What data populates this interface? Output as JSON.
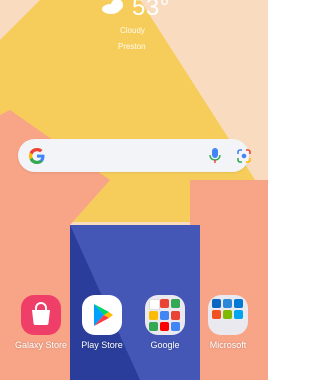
{
  "weather": {
    "temperature": "53°",
    "condition": "Cloudy",
    "location": "Preston",
    "icon": "partly-cloudy-icon"
  },
  "search": {
    "value": "",
    "icons": [
      "google-g-icon",
      "microphone-icon",
      "google-lens-icon"
    ]
  },
  "apps": [
    {
      "label": "Galaxy Store",
      "icon": "shopping-bag-icon",
      "color": "#ef3f68"
    },
    {
      "label": "Play Store",
      "icon": "play-triangle-icon",
      "color": "#ffffff"
    },
    {
      "label": "Google",
      "icon": "folder-icon",
      "color": "#e9e9ef"
    },
    {
      "label": "Microsoft",
      "icon": "folder-icon",
      "color": "#e9e9ef"
    }
  ],
  "colors": {
    "wallpaper_peach": "#f9dcc0",
    "wallpaper_yellow": "#f6cd5a",
    "wallpaper_salmon": "#f7a487",
    "wallpaper_navy": "#2a3d9a",
    "wallpaper_blue": "#5a6ed0"
  }
}
